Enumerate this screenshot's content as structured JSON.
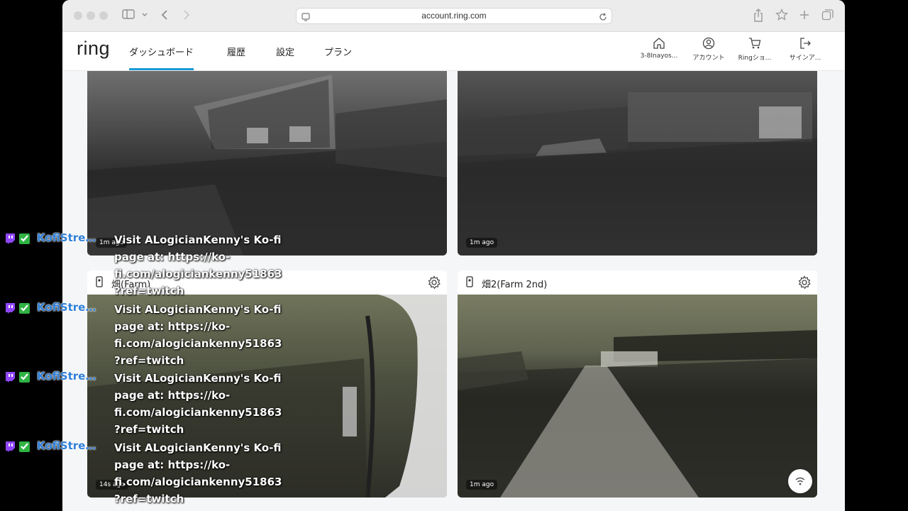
{
  "browser": {
    "url": "account.ring.com"
  },
  "header": {
    "logo": "ring",
    "tabs": [
      {
        "label": "ダッシュボード",
        "active": true
      },
      {
        "label": "履歴"
      },
      {
        "label": "設定"
      },
      {
        "label": "プラン"
      }
    ],
    "actions": [
      {
        "label": "3-8Inayos...",
        "icon": "home-icon"
      },
      {
        "label": "アカウント",
        "icon": "account-icon"
      },
      {
        "label": "Ringショ...",
        "icon": "cart-icon"
      },
      {
        "label": "サインア...",
        "icon": "sign-out-icon"
      }
    ]
  },
  "cameras": [
    {
      "name": "",
      "time": "1m ago"
    },
    {
      "name": "",
      "time": "1m ago"
    },
    {
      "name": "畑(Farm)",
      "time": "14s ago"
    },
    {
      "name": "畑2(Farm 2nd)",
      "time": "1m ago"
    }
  ],
  "overlay": {
    "username": "KofiStrea...",
    "message_lines": [
      "Visit ALogicianKenny's Ko-fi",
      "page at: https://ko-",
      "fi.com/alogiciankenny51863",
      "?ref=twitch"
    ],
    "accent_color": "#2f7fd8"
  }
}
